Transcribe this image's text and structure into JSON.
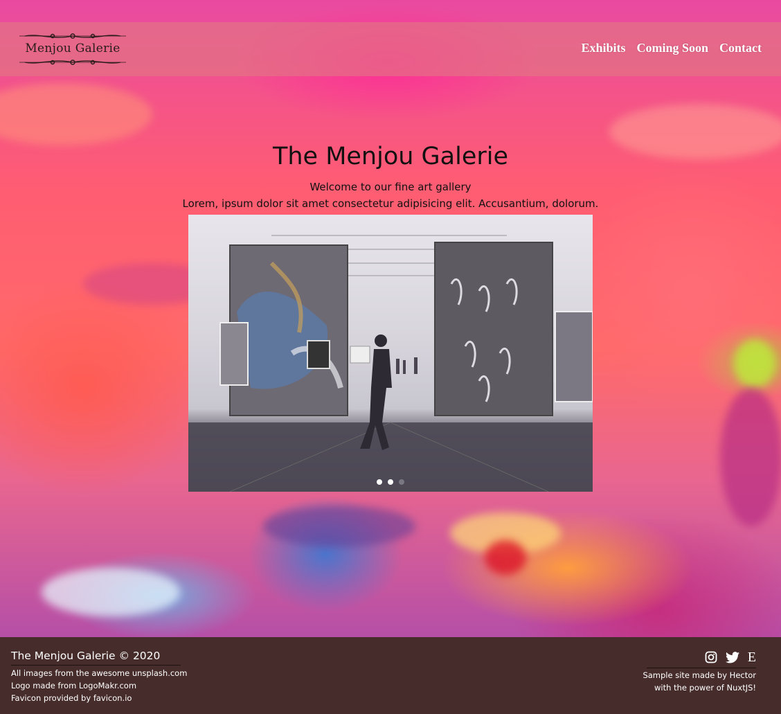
{
  "header": {
    "logo_text": "Menjou Galerie",
    "nav": [
      "Exhibits",
      "Coming Soon",
      "Contact"
    ]
  },
  "hero": {
    "title": "The Menjou Galerie",
    "subtitle": "Welcome to our fine art gallery",
    "description": "Lorem, ipsum dolor sit amet consectetur adipisicing elit. Accusantium, dolorum."
  },
  "carousel": {
    "slides": 3,
    "active_slide": 2
  },
  "footer": {
    "title": "The Menjou Galerie © 2020",
    "credits": [
      "All images from the awesome unsplash.com",
      "Logo made from LogoMakr.com",
      "Favicon provided by favicon.io"
    ],
    "social_icons": [
      "instagram-icon",
      "twitter-icon",
      "etsy-icon"
    ],
    "made_by": [
      "Sample site made by Hector",
      "with the power of NuxtJS!"
    ]
  },
  "colors": {
    "footer_bg": "#462d2b",
    "header_bg": "rgba(225,120,130,.62)",
    "nav_text": "#ffffff"
  }
}
